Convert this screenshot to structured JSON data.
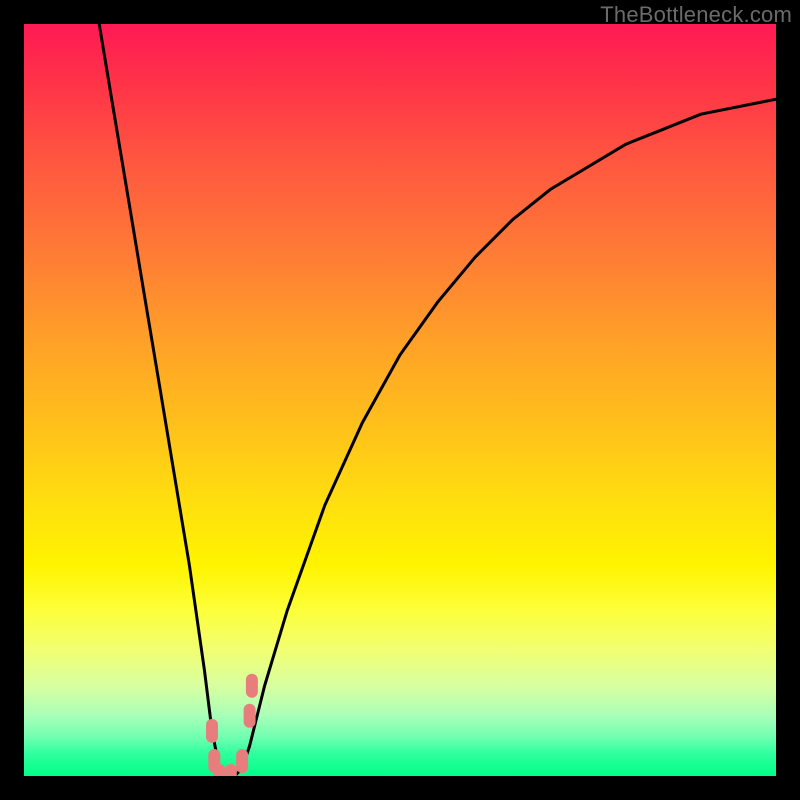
{
  "watermark": "TheBottleneck.com",
  "chart_data": {
    "type": "line",
    "title": "",
    "xlabel": "",
    "ylabel": "",
    "xlim": [
      0,
      100
    ],
    "ylim": [
      0,
      100
    ],
    "grid": false,
    "legend": false,
    "curve_note": "V-shaped bottleneck curve; x ≈ relative hardware balance, y ≈ bottleneck % (0 at trough). Values estimated from pixel positions against full-range gradient.",
    "series": [
      {
        "name": "bottleneck-curve",
        "color": "#000000",
        "x": [
          10,
          12,
          14,
          16,
          18,
          20,
          22,
          24,
          25,
          26,
          27,
          28,
          29,
          30,
          32,
          35,
          40,
          45,
          50,
          55,
          60,
          65,
          70,
          75,
          80,
          85,
          90,
          95,
          100
        ],
        "y": [
          100,
          88,
          76,
          64,
          52,
          40,
          28,
          14,
          6,
          1,
          0,
          0,
          1,
          4,
          12,
          22,
          36,
          47,
          56,
          63,
          69,
          74,
          78,
          81,
          84,
          86,
          88,
          89,
          90
        ]
      }
    ],
    "markers": [
      {
        "name": "trough-marker-left",
        "x": 25.0,
        "y": 6,
        "color": "#e77d7d"
      },
      {
        "name": "trough-marker-left2",
        "x": 25.3,
        "y": 2,
        "color": "#e77d7d"
      },
      {
        "name": "trough-marker-mid1",
        "x": 26.0,
        "y": 0,
        "color": "#e77d7d"
      },
      {
        "name": "trough-marker-mid2",
        "x": 27.5,
        "y": 0,
        "color": "#e77d7d"
      },
      {
        "name": "trough-marker-right2",
        "x": 29.0,
        "y": 2,
        "color": "#e77d7d"
      },
      {
        "name": "trough-marker-right",
        "x": 30.0,
        "y": 8,
        "color": "#e77d7d"
      },
      {
        "name": "trough-marker-right3",
        "x": 30.3,
        "y": 12,
        "color": "#e77d7d"
      }
    ],
    "gradient_stops": [
      {
        "pos": 0,
        "color": "#ff1a54"
      },
      {
        "pos": 18,
        "color": "#ff5640"
      },
      {
        "pos": 42,
        "color": "#ffa028"
      },
      {
        "pos": 64,
        "color": "#ffe00e"
      },
      {
        "pos": 83,
        "color": "#f2ff70"
      },
      {
        "pos": 95,
        "color": "#6cffb0"
      },
      {
        "pos": 100,
        "color": "#00ff88"
      }
    ]
  }
}
